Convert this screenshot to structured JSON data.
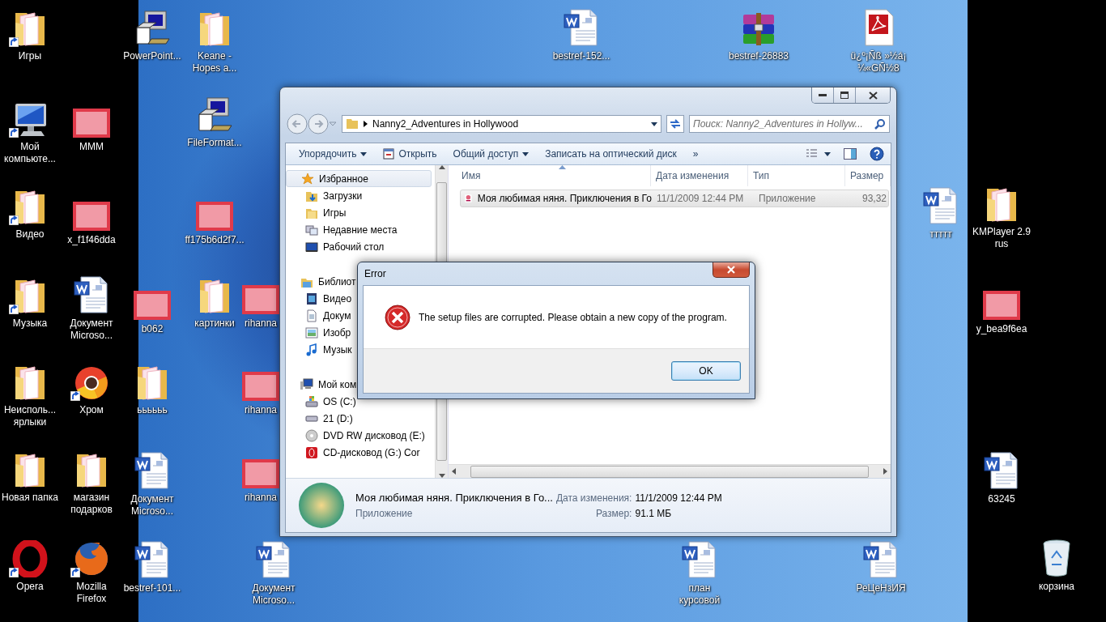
{
  "desktop_icons": [
    {
      "kind": "folder",
      "label": "Игры",
      "shortcut": true
    },
    {
      "kind": "installer",
      "label": "PowerPoint...",
      "shortcut": false
    },
    {
      "kind": "folder",
      "label": "Keane - Hopes a...",
      "shortcut": false
    },
    {
      "kind": "word",
      "label": "bestref-152...",
      "shortcut": false
    },
    {
      "kind": "archive",
      "label": "bestref-26883",
      "shortcut": false
    },
    {
      "kind": "pdf",
      "label": "ü¿º¡Ñß »½á¡ ¼«GÑ½8",
      "shortcut": false
    },
    {
      "kind": "computer",
      "label": "Мой компьюте...",
      "shortcut": true
    },
    {
      "kind": "picture",
      "label": "MMM",
      "shortcut": false
    },
    {
      "kind": "installer",
      "label": "FileFormat...",
      "shortcut": false
    },
    {
      "kind": "folder",
      "label": "Видео",
      "shortcut": true
    },
    {
      "kind": "picture",
      "label": "x_f1f46dda",
      "shortcut": false
    },
    {
      "kind": "picture",
      "label": "ff175b6d2f7...",
      "shortcut": false
    },
    {
      "kind": "word",
      "label": "ттттт",
      "shortcut": false
    },
    {
      "kind": "folder",
      "label": "KMPlayer 2.9 rus",
      "shortcut": false
    },
    {
      "kind": "folder",
      "label": "Музыка",
      "shortcut": true
    },
    {
      "kind": "word",
      "label": "Документ Microso...",
      "shortcut": false
    },
    {
      "kind": "picture",
      "label": "b062",
      "shortcut": false
    },
    {
      "kind": "folder",
      "label": "картинки",
      "shortcut": false
    },
    {
      "kind": "picture",
      "label": "rihanna",
      "shortcut": false
    },
    {
      "kind": "picture",
      "label": "y_bea9f6ea",
      "shortcut": false
    },
    {
      "kind": "folder",
      "label": "Неисполь... ярлыки",
      "shortcut": false
    },
    {
      "kind": "chrome",
      "label": "Хром",
      "shortcut": true
    },
    {
      "kind": "folder",
      "label": "ьььььь",
      "shortcut": false
    },
    {
      "kind": "picture",
      "label": "rihanna",
      "shortcut": false
    },
    {
      "kind": "folder",
      "label": "Новая папка",
      "shortcut": false
    },
    {
      "kind": "folder",
      "label": "магазин подарков",
      "shortcut": false
    },
    {
      "kind": "word",
      "label": "Документ Microso...",
      "shortcut": false
    },
    {
      "kind": "picture",
      "label": "rihanna",
      "shortcut": false
    },
    {
      "kind": "word",
      "label": "63245",
      "shortcut": false
    },
    {
      "kind": "opera",
      "label": "Opera",
      "shortcut": true
    },
    {
      "kind": "firefox",
      "label": "Mozilla Firefox",
      "shortcut": true
    },
    {
      "kind": "word",
      "label": "bestref-101...",
      "shortcut": false
    },
    {
      "kind": "word",
      "label": "Документ Microso...",
      "shortcut": false
    },
    {
      "kind": "word",
      "label": "план курсовой",
      "shortcut": false
    },
    {
      "kind": "word",
      "label": "РеЦеНзИЯ",
      "shortcut": false
    },
    {
      "kind": "recycle",
      "label": "корзина",
      "shortcut": false
    }
  ],
  "explorer": {
    "address": {
      "path": "Nanny2_Adventures in Hollywood"
    },
    "search": {
      "placeholder": "Поиск: Nanny2_Adventures in Hollyw..."
    },
    "toolbar": [
      {
        "kind": "dropdown",
        "label": "Упорядочить"
      },
      {
        "kind": "open",
        "label": "Открыть"
      },
      {
        "kind": "dropdown",
        "label": "Общий доступ"
      },
      {
        "kind": "plain",
        "label": "Записать на оптический диск"
      },
      {
        "kind": "plain",
        "label": "»"
      }
    ],
    "navigation": [
      {
        "kind": "star",
        "label": "Избранное",
        "selected": true,
        "children": [
          {
            "kind": "downloads",
            "label": "Загрузки",
            "selected": false
          },
          {
            "kind": "folder",
            "label": "Игры",
            "selected": false
          },
          {
            "kind": "recent",
            "label": "Недавние места",
            "selected": false
          },
          {
            "kind": "desktop",
            "label": "Рабочий стол",
            "selected": false
          }
        ]
      },
      {
        "kind": "library",
        "label": "Библиот",
        "selected": false,
        "children": [
          {
            "kind": "video",
            "label": "Видео",
            "selected": false
          },
          {
            "kind": "document",
            "label": "Докум",
            "selected": false
          },
          {
            "kind": "pictures",
            "label": "Изобр",
            "selected": false
          },
          {
            "kind": "music",
            "label": "Музык",
            "selected": false
          }
        ]
      },
      {
        "kind": "computer",
        "label": "Мой ком",
        "selected": false,
        "children": [
          {
            "kind": "os-drive",
            "label": "OS (C:)",
            "selected": false
          },
          {
            "kind": "drive",
            "label": "21 (D:)",
            "selected": false
          },
          {
            "kind": "dvd",
            "label": "DVD RW дисковод (E:)",
            "selected": false
          },
          {
            "kind": "cd",
            "label": "CD-дисковод (G:) Cor",
            "selected": false
          }
        ]
      }
    ],
    "file_list": {
      "columns": [
        "Имя",
        "Дата изменения",
        "Тип",
        "Размер"
      ],
      "rows": [
        {
          "name": "Моя любимая няня. Приключения в Го",
          "date": "11/1/2009 12:44 PM",
          "type": "Приложение",
          "size": "93,32",
          "selected": true
        }
      ]
    },
    "details": {
      "name": "Моя любимая няня. Приключения в Го...",
      "type": "Приложение",
      "date_label": "Дата изменения:",
      "date": "11/1/2009 12:44 PM",
      "size_label": "Размер:",
      "size": "91.1 МБ"
    }
  },
  "dialog": {
    "title": "Error",
    "message": "The setup files are corrupted. Please obtain a new copy of the program.",
    "buttons": [
      "OK"
    ]
  }
}
